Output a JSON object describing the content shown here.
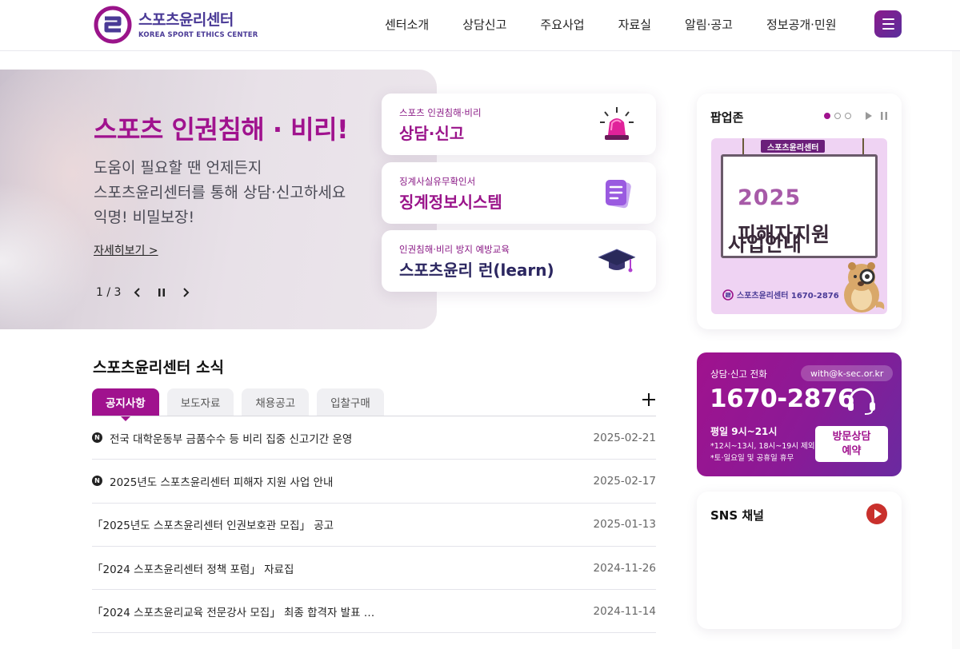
{
  "header": {
    "logo_ko": "스포츠윤리센터",
    "logo_en": "KOREA SPORT ETHICS CENTER",
    "nav": [
      "센터소개",
      "상담신고",
      "주요사업",
      "자료실",
      "알림·공고",
      "정보공개·민원"
    ],
    "menu_icon": "hamburger-icon"
  },
  "hero": {
    "title": "스포츠 인권침해 · 비리!",
    "desc": [
      "도움이 필요할 땐 언제든지",
      "스포츠윤리센터를 통해 상담·신고하세요",
      "익명! 비밀보장!"
    ],
    "more": "자세히보기 >",
    "pager": "1 / 3"
  },
  "quick_cards": [
    {
      "sub": "스포츠 인권침해·비리",
      "main": "상담·신고",
      "icon": "siren-icon"
    },
    {
      "sub": "징계사실유무확인서",
      "main": "징계정보시스템",
      "icon": "document-icon"
    },
    {
      "sub": "인권침해·비리 방지 예방교육",
      "main": "스포츠윤리 런(learn)",
      "icon": "graduation-cap-icon"
    }
  ],
  "news": {
    "title": "스포츠윤리센터 소식",
    "tabs": [
      "공지사항",
      "보도자료",
      "채용공고",
      "입찰구매"
    ],
    "active_tab": 0,
    "items": [
      {
        "new": true,
        "text": "전국 대학운동부 금품수수 등 비리 집중 신고기간 운영",
        "date": "2025-02-21"
      },
      {
        "new": true,
        "text": "2025년도 스포츠윤리센터 피해자 지원 사업 안내",
        "date": "2025-02-17"
      },
      {
        "new": false,
        "text": "「2025년도 스포츠윤리센터 인권보호관 모집」 공고",
        "date": "2025-01-13"
      },
      {
        "new": false,
        "text": "「2024 스포츠윤리센터 정책 포럼」 자료집",
        "date": "2024-11-26"
      },
      {
        "new": false,
        "text": "「2024 스포츠윤리교육 전문강사 모집」 최종 합격자 발표 …",
        "date": "2024-11-14"
      }
    ],
    "new_badge": "N"
  },
  "popup": {
    "title": "팝업존",
    "board_tag": "스포츠윤리센터",
    "year": "2025",
    "line1": "피해자지원",
    "line2": "사업안내",
    "footer": "스포츠윤리센터 1670-2876"
  },
  "phone": {
    "label": "상담·신고 전화",
    "email": "with@k-sec.or.kr",
    "number": "1670-2876",
    "hours": "평일 9시~21시",
    "note1": "*12시~13시, 18시~19시 제외",
    "note2": "*토·일요일 및 공휴일 휴무",
    "visit_line1": "방문상담",
    "visit_line2": "예약"
  },
  "sns": {
    "title": "SNS 채널"
  },
  "colors": {
    "brand_magenta": "#a0128e",
    "brand_navy": "#4a3a96"
  }
}
